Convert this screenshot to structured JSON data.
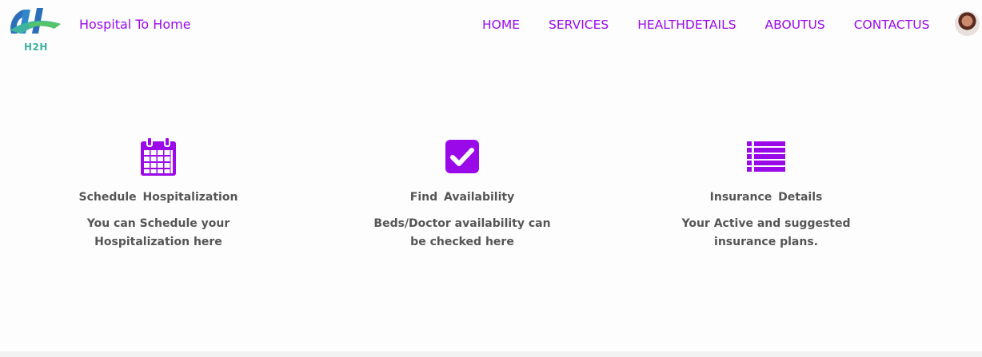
{
  "header": {
    "logo_text": "H2H",
    "brand": "Hospital To Home",
    "nav": [
      "HOME",
      "SERVICES",
      "HEALTHDETAILS",
      "ABOUTUS",
      "CONTACTUS"
    ]
  },
  "features": [
    {
      "icon": "calendar-icon",
      "title": "Schedule  Hospitalization",
      "description": "You can Schedule your Hospitalization here"
    },
    {
      "icon": "check-square-icon",
      "title": "Find  Availability",
      "description": "Beds/Doctor availability can be checked here"
    },
    {
      "icon": "list-icon",
      "title": "Insurance  Details",
      "description": "Your Active and suggested insurance plans."
    }
  ],
  "colors": {
    "accent": "#9a0ae8",
    "text": "#555555",
    "logo_blue": "#2b6fb8",
    "logo_teal": "#3fb3a0"
  }
}
